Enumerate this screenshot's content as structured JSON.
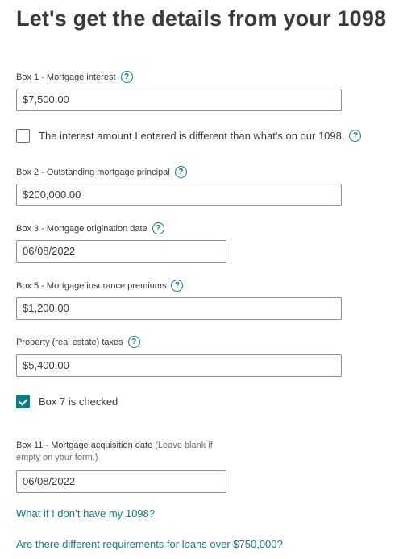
{
  "page": {
    "title": "Let's get the details from your 1098"
  },
  "help_icon_glyph": "?",
  "box1": {
    "label": "Box 1 - Mortgage interest",
    "value": "$7,500.00"
  },
  "interest_different": {
    "label": "The interest amount I entered is different than what's on our 1098.",
    "checked": false
  },
  "box2": {
    "label": "Box 2 - Outstanding mortgage principal",
    "value": "$200,000.00"
  },
  "box3": {
    "label": "Box 3 - Mortgage origination date",
    "value": "06/08/2022"
  },
  "box5": {
    "label": "Box 5 - Mortgage insurance premiums",
    "value": "$1,200.00"
  },
  "property_taxes": {
    "label": "Property (real estate) taxes",
    "value": "$5,400.00"
  },
  "box7": {
    "label": "Box 7 is checked",
    "checked": true
  },
  "box11": {
    "label": "Box 11 - Mortgage acquisition date",
    "note": "(Leave blank if empty on your form.)",
    "value": "06/08/2022"
  },
  "links": {
    "no_1098": "What if I don’t have my 1098?",
    "loans_over": "Are there different requirements for loans over $750,000?"
  },
  "colors": {
    "accent": "#0f7d84",
    "text": "#393a3d",
    "border": "#8d9096"
  }
}
